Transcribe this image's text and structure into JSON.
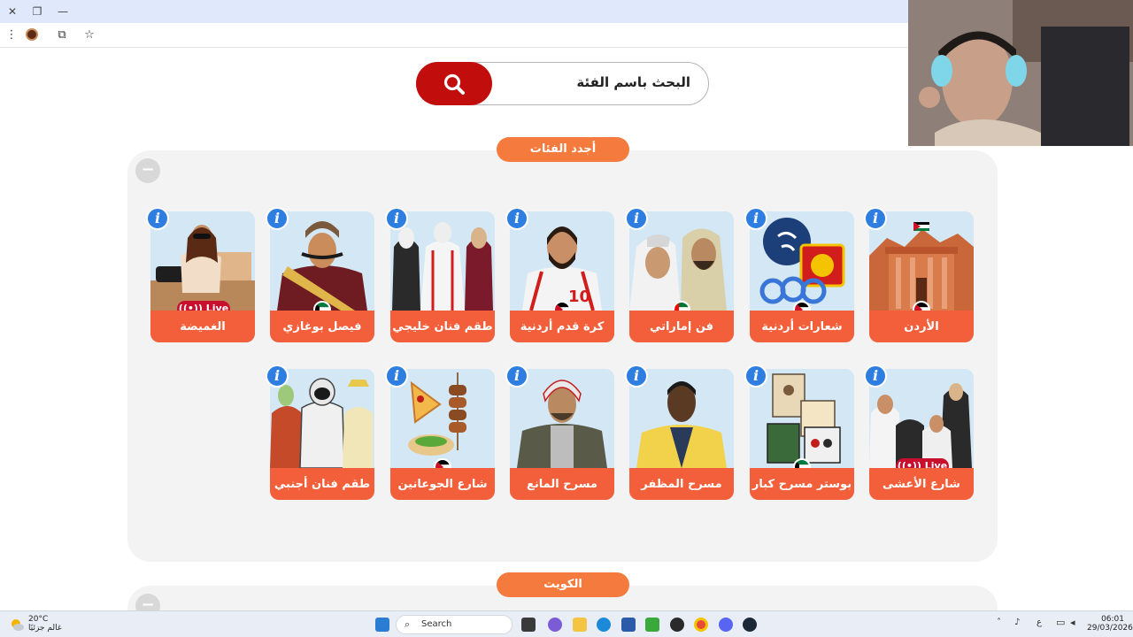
{
  "search": {
    "placeholder": "البحث باسم الفئة"
  },
  "sections": [
    {
      "title": "أجدد الفئات"
    },
    {
      "title": "الكويت"
    }
  ],
  "cards": [
    {
      "label": "الأردن",
      "flag": "jordan",
      "live": false
    },
    {
      "label": "شعارات أردنية",
      "flag": "jordan",
      "live": false
    },
    {
      "label": "فن إماراتي",
      "flag": "uae",
      "live": false
    },
    {
      "label": "كرة قدم أردنية",
      "flag": "jordan",
      "live": false
    },
    {
      "label": "طقم فنان خليجي",
      "flag": "",
      "live": false
    },
    {
      "label": "فيصل بوغازي",
      "flag": "kuwait",
      "live": false
    },
    {
      "label": "الغميضة",
      "flag": "",
      "live": true
    },
    {
      "label": "شارع الأعشى",
      "flag": "",
      "live": true
    },
    {
      "label": "بوستر مسرح كبار",
      "flag": "kuwait",
      "live": false
    },
    {
      "label": "مسرح المظفر",
      "flag": "",
      "live": false
    },
    {
      "label": "مسرح المانع",
      "flag": "",
      "live": false
    },
    {
      "label": "شارع الجوعانين",
      "flag": "jordan",
      "live": false
    },
    {
      "label": "طقم فنان أجنبي",
      "flag": "",
      "live": false
    }
  ],
  "badges": {
    "live": "Live",
    "info": "i",
    "collapse": "−"
  },
  "taskbar": {
    "search_label": "Search",
    "weather_temp": "20°C",
    "weather_desc": "غالم جزئيًا",
    "time": "06:01",
    "date": "29/03/2026",
    "lang": "ع"
  },
  "colors": {
    "accent_orange": "#f47a3d",
    "card_label": "#f25f3a",
    "search_red": "#c20d0d",
    "info_blue": "#2d7ee0",
    "live_red": "#c8102e",
    "card_bg": "#d3e7f5",
    "panel_bg": "#f3f3f3"
  }
}
